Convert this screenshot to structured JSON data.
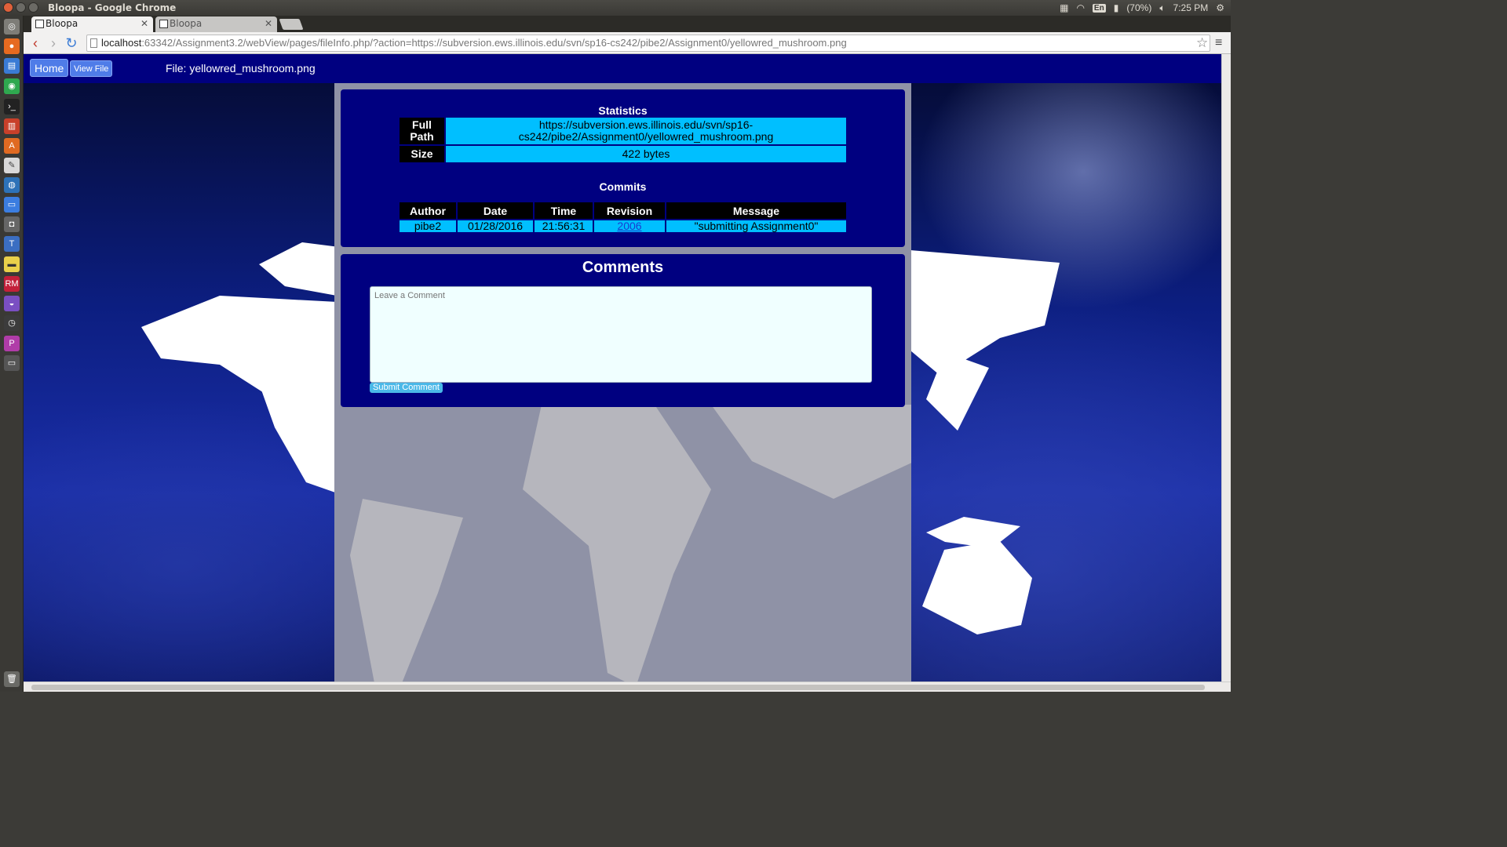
{
  "os": {
    "window_title": "Bloopa - Google Chrome",
    "language": "En",
    "battery": "(70%)",
    "clock": "7:25 PM"
  },
  "browser": {
    "tabs": [
      {
        "title": "Bloopa",
        "active": true
      },
      {
        "title": "Bloopa",
        "active": false
      }
    ],
    "url_host": "localhost",
    "url_rest": ":63342/Assignment3.2/webView/pages/fileInfo.php/?action=https://subversion.ews.illinois.edu/svn/sp16-cs242/pibe2/Assignment0/yellowred_mushroom.png"
  },
  "header": {
    "home_label": "Home",
    "view_file_label": "View File",
    "file_label": "File: yellowred_mushroom.png"
  },
  "statistics": {
    "title": "Statistics",
    "full_path_label": "Full Path",
    "full_path_value": "https://subversion.ews.illinois.edu/svn/sp16-cs242/pibe2/Assignment0/yellowred_mushroom.png",
    "size_label": "Size",
    "size_value": "422 bytes"
  },
  "commits": {
    "title": "Commits",
    "columns": [
      "Author",
      "Date",
      "Time",
      "Revision",
      "Message"
    ],
    "rows": [
      {
        "author": "pibe2",
        "date": "01/28/2016",
        "time": "21:56:31",
        "revision": "2006",
        "message": "\"submitting Assignment0\""
      }
    ]
  },
  "comments": {
    "title": "Comments",
    "placeholder": "Leave a Comment",
    "submit_label": "Submit Comment"
  },
  "colors": {
    "header_bg": "#000080",
    "panel_bg": "#000080",
    "cell_bg": "#00bfff",
    "button_bg": "#4f7ce8"
  }
}
